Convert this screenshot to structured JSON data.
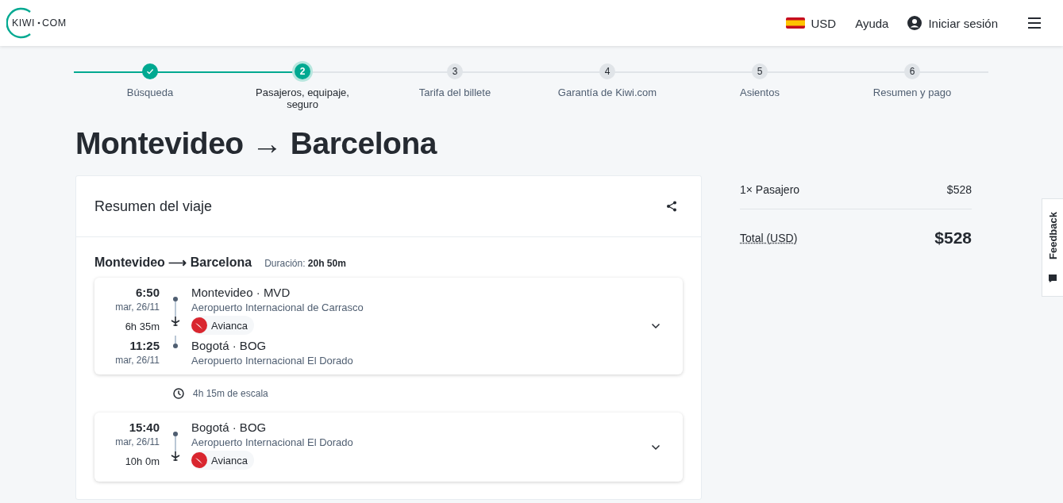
{
  "header": {
    "logo_left": "KIWI",
    "logo_right": "COM",
    "currency": "USD",
    "help": "Ayuda",
    "login": "Iniciar sesión"
  },
  "steps": [
    {
      "label": "Búsqueda",
      "kind": "done"
    },
    {
      "number": "2",
      "label": "Pasajeros, equipaje, seguro",
      "kind": "current"
    },
    {
      "number": "3",
      "label": "Tarifa del billete",
      "kind": "todo"
    },
    {
      "number": "4",
      "label": "Garantía de Kiwi.com",
      "kind": "todo"
    },
    {
      "number": "5",
      "label": "Asientos",
      "kind": "todo"
    },
    {
      "number": "6",
      "label": "Resumen y pago",
      "kind": "todo"
    }
  ],
  "title": "Montevideo → Barcelona",
  "trip": {
    "heading": "Resumen del viaje",
    "route": "Montevideo ⟶ Barcelona",
    "duration_label": "Duración:",
    "duration": "20h 50m",
    "legs": [
      {
        "depart": {
          "time": "6:50",
          "date": "mar, 26/11",
          "place": "Montevideo · MVD",
          "airport": "Aeropuerto Internacional de Carrasco"
        },
        "duration": "6h 35m",
        "airline": "Avianca",
        "arrive": {
          "time": "11:25",
          "date": "mar, 26/11",
          "place": "Bogotá · BOG",
          "airport": "Aeropuerto Internacional El Dorado"
        }
      },
      {
        "depart": {
          "time": "15:40",
          "date": "mar, 26/11",
          "place": "Bogotá · BOG",
          "airport": "Aeropuerto Internacional El Dorado"
        },
        "duration": "10h 0m",
        "airline": "Avianca"
      }
    ],
    "layover": "4h 15m de escala"
  },
  "summary": {
    "passenger_label": "1× Pasajero",
    "passenger_price": "$528",
    "total_label": "Total (USD)",
    "total": "$528"
  },
  "feedback": "Feedback"
}
